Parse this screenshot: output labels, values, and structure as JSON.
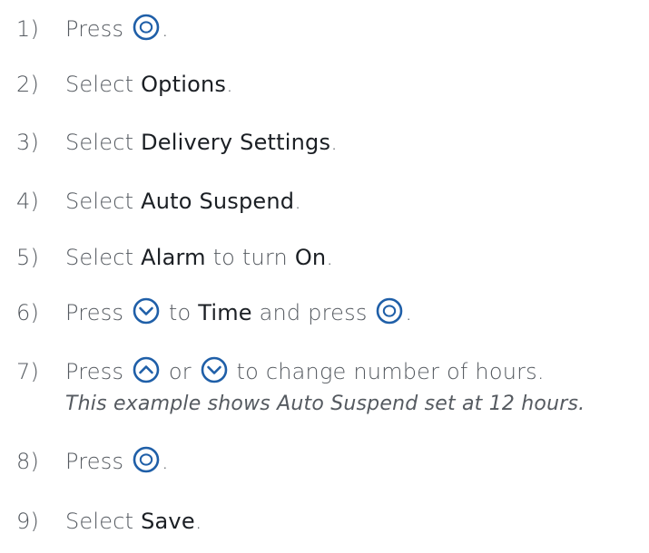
{
  "colors": {
    "text": "#555a60",
    "emphasis": "#1b1f24",
    "button_icon": "#1f5fa8"
  },
  "steps": [
    {
      "num": "1)",
      "press": "Press",
      "end": "."
    },
    {
      "num": "2)",
      "select": "Select",
      "target": "Options",
      "end": "."
    },
    {
      "num": "3)",
      "select": "Select",
      "target": "Delivery Settings",
      "end": "."
    },
    {
      "num": "4)",
      "select": "Select",
      "target": "Auto Suspend",
      "end": "."
    },
    {
      "num": "5)",
      "select": "Select",
      "target": "Alarm",
      "middle": "to turn",
      "target2": "On",
      "end": "."
    },
    {
      "num": "6)",
      "press": "Press",
      "to": "to",
      "target": "Time",
      "and": "and press",
      "end": "."
    },
    {
      "num": "7)",
      "press": "Press",
      "or": "or",
      "rest": "to change number of hours.",
      "note": "This example shows Auto Suspend set at 12 hours."
    },
    {
      "num": "8)",
      "press": "Press",
      "end": "."
    },
    {
      "num": "9)",
      "select": "Select",
      "target": "Save",
      "end": "."
    }
  ],
  "icons": [
    "select-button-icon",
    "down-arrow-button-icon",
    "up-arrow-button-icon"
  ]
}
